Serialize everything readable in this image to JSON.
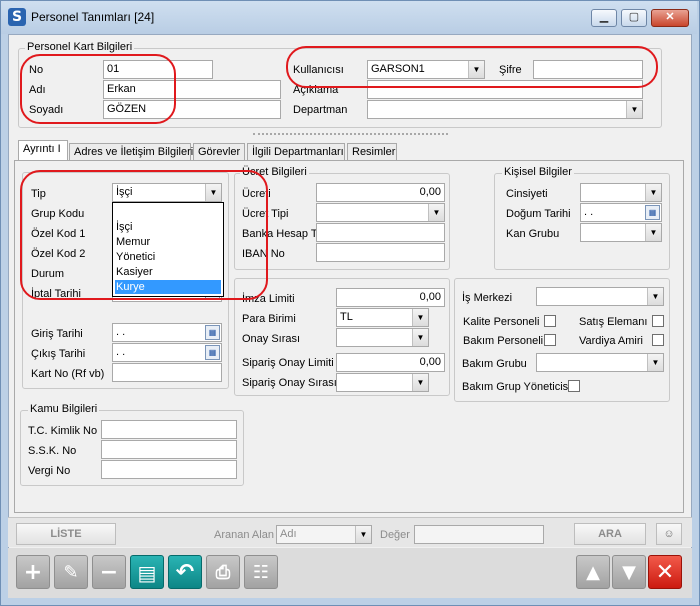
{
  "window": {
    "title": "Personel Tanımları  [24]",
    "minimize": "▁",
    "maximize": "▢",
    "close": "✕",
    "app_icon": "S"
  },
  "card": {
    "group_title": "Personel Kart Bilgileri",
    "no_label": "No",
    "no_value": "01",
    "adi_label": "Adı",
    "adi_value": "Erkan",
    "soyadi_label": "Soyadı",
    "soyadi_value": "GÖZEN",
    "kullanici_label": "Kullanıcısı",
    "kullanici_value": "GARSON1",
    "sifre_label": "Şifre",
    "sifre_value": "",
    "aciklama_label": "Açıklama",
    "aciklama_value": "",
    "departman_label": "Departman",
    "departman_value": ""
  },
  "tabs": [
    {
      "label": "Ayrıntı I"
    },
    {
      "label": "Adres ve İletişim Bilgileri"
    },
    {
      "label": "Görevler"
    },
    {
      "label": "İlgili Departmanları"
    },
    {
      "label": "Resimler"
    }
  ],
  "details": {
    "tip_label": "Tip",
    "tip_value": "İşçi",
    "grup_kodu_label": "Grup Kodu",
    "ozel_kod1_label": "Özel Kod 1",
    "ozel_kod2_label": "Özel Kod 2",
    "durum_label": "Durum",
    "iptal_label": "İptal Tarihi",
    "giris_label": "Giriş Tarihi",
    "giris_value": ". .",
    "cikis_label": "Çıkış Tarihi",
    "cikis_value": ". .",
    "kart_no_label": "Kart No (Rf vb)",
    "kart_no_value": ""
  },
  "tip_dropdown": {
    "options": [
      "",
      "İşçi",
      "Memur",
      "Yönetici",
      "Kasiyer",
      "Kurye"
    ],
    "selected": "Kurye"
  },
  "ucret": {
    "group_title": "Ücret Bilgileri",
    "ucret_label": "Ücreti",
    "ucret_value": "0,00",
    "ucret_tipi_label": "Ücret Tipi",
    "banka_label": "Banka Hesap T",
    "iban_label": "IBAN No"
  },
  "kisisel": {
    "group_title": "Kişisel Bilgiler",
    "cinsiyet_label": "Cinsiyeti",
    "dogum_label": "Doğum Tarihi",
    "dogum_value": ". .",
    "kan_label": "Kan Grubu"
  },
  "imza": {
    "imza_label": "İmza Limiti",
    "imza_value": "0,00",
    "para_label": "Para Birimi",
    "para_value": "TL",
    "onay_label": "Onay Sırası",
    "siparis_limit_label": "Sipariş Onay Limiti",
    "siparis_limit_value": "0,00",
    "siparis_sira_label": "Sipariş Onay Sırası"
  },
  "is_merkezi": {
    "is_merkezi_label": "İş Merkezi",
    "kalite_label": "Kalite Personeli",
    "satis_label": "Satış Elemanı",
    "bakim_label": "Bakım Personeli",
    "vardiya_label": "Vardiya Amiri",
    "bakim_grubu_label": "Bakım Grubu",
    "bakim_grup_yon_label": "Bakım Grup Yöneticisi"
  },
  "kamu": {
    "group_title": "Kamu Bilgileri",
    "tc_label": "T.C. Kimlik No",
    "ssk_label": "S.S.K. No",
    "vergi_label": "Vergi No"
  },
  "search_bar": {
    "liste_label": "LİSTE",
    "aranan_alan_label": "Aranan Alan",
    "aranan_alan_value": "Adı",
    "deger_label": "Değer",
    "deger_value": "",
    "ara_label": "ARA"
  },
  "toolbar": {
    "add": "+",
    "edit": "✎",
    "delete": "−",
    "save": "▤",
    "undo": "↶",
    "print": "⎙",
    "tree": "☷",
    "up": "▲",
    "down": "▼",
    "close": "✕"
  },
  "colors": {
    "highlight_red": "#e0191d",
    "selection_blue": "#3399ff",
    "close_red": "#cc1a10",
    "undo_teal": "#0d8686"
  }
}
